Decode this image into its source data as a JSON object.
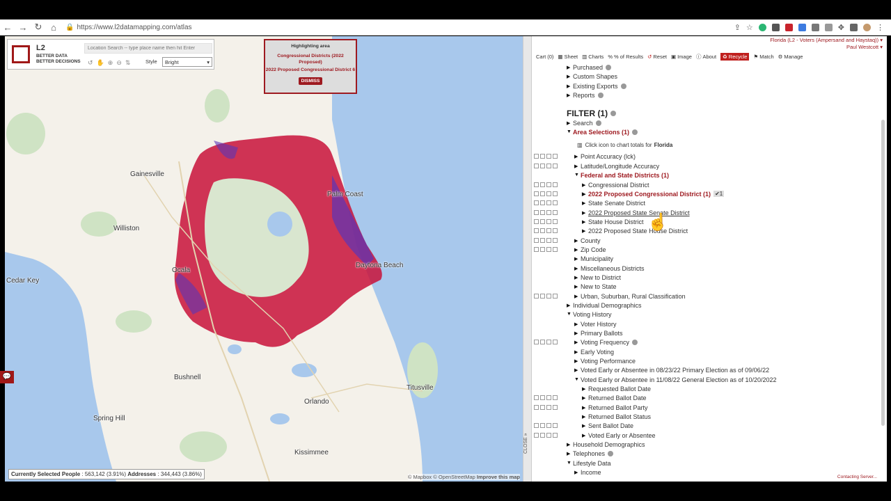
{
  "browser": {
    "url": "https://www.l2datamapping.com/atlas",
    "nav": [
      "back-icon",
      "forward-icon",
      "reload-icon",
      "home-icon"
    ]
  },
  "map": {
    "logo_title": "L2",
    "logo_tagline": "BETTER DATA\nBETTER DECISIONS",
    "search_placeholder": "Location Search -- type place name then hit Enter",
    "style_label": "Style",
    "style_value": "Bright",
    "highlight": {
      "title": "Highlighting area",
      "line1": "Congressional Districts (2022 Proposed)",
      "line2": "2022 Proposed Congressional District 6",
      "dismiss": "DISMISS"
    },
    "cities": [
      "Gainesville",
      "Palm Coast",
      "Williston",
      "Ocala",
      "Daytona Beach",
      "Cedar Key",
      "Bushnell",
      "Titusville",
      "Orlando",
      "Spring Hill",
      "Kissimmee"
    ],
    "status": {
      "people_label": "Currently Selected People",
      "people_value": "563,142 (3.91%)",
      "addresses_label": "Addresses",
      "addresses_value": "344,443 (3.86%)"
    },
    "attribution": "© Mapbox © OpenStreetMap",
    "improve": "Improve this map",
    "close_tab": "CLOSE"
  },
  "panel": {
    "app_title": "Florida (L2 - Voters (Ampersand and Haystaq))",
    "user": "Paul Westcott",
    "tools": {
      "cart": "Cart (0)",
      "sheet": "Sheet",
      "charts": "Charts",
      "results": "% of Results",
      "reset": "Reset",
      "image": "Image",
      "about": "About",
      "recycle": "Recycle",
      "match": "Match",
      "manage": "Manage"
    },
    "rows": [
      {
        "label": "Purchased",
        "indent": 0
      },
      {
        "label": "Custom Shapes",
        "indent": 0
      },
      {
        "label": "Existing Exports",
        "indent": 0
      },
      {
        "label": "Reports",
        "indent": 0
      },
      {
        "label": "FILTER (1)",
        "indent": 0
      },
      {
        "label": "Search",
        "indent": 0
      },
      {
        "label": "Area Selections (1)",
        "indent": 0
      },
      {
        "label": "Click icon to chart totals for",
        "indent": 1
      },
      {
        "label": "Point Accuracy (lck)",
        "indent": 1
      },
      {
        "label": "Latitude/Longitude Accuracy",
        "indent": 1
      },
      {
        "label": "Federal and State Districts (1)",
        "indent": 1
      },
      {
        "label": "Congressional District",
        "indent": 2
      },
      {
        "label": "2022 Proposed Congressional District (1)",
        "indent": 2
      },
      {
        "label": "State Senate District",
        "indent": 2
      },
      {
        "label": "2022 Proposed State Senate District",
        "indent": 2
      },
      {
        "label": "State House District",
        "indent": 2
      },
      {
        "label": "2022 Proposed State House District",
        "indent": 2
      },
      {
        "label": "County",
        "indent": 1
      },
      {
        "label": "Zip Code",
        "indent": 1
      },
      {
        "label": "Municipality",
        "indent": 1
      },
      {
        "label": "Miscellaneous Districts",
        "indent": 1
      },
      {
        "label": "New to District",
        "indent": 1
      },
      {
        "label": "New to State",
        "indent": 1
      },
      {
        "label": "Urban, Suburban, Rural Classification",
        "indent": 1
      },
      {
        "label": "Individual Demographics",
        "indent": 0
      },
      {
        "label": "Voting History",
        "indent": 0
      },
      {
        "label": "Voter History",
        "indent": 1
      },
      {
        "label": "Primary Ballots",
        "indent": 1
      },
      {
        "label": "Voting Frequency",
        "indent": 1
      },
      {
        "label": "Early Voting",
        "indent": 1
      },
      {
        "label": "Voting Performance",
        "indent": 1
      },
      {
        "label": "Voted Early or Absentee in 08/23/22 Primary Election as of 09/06/22",
        "indent": 1
      },
      {
        "label": "Voted Early or Absentee in 11/08/22 General Election as of 10/20/2022",
        "indent": 1
      },
      {
        "label": "Requested Ballot Date",
        "indent": 2
      },
      {
        "label": "Returned Ballot Date",
        "indent": 2
      },
      {
        "label": "Returned Ballot Party",
        "indent": 2
      },
      {
        "label": "Returned Ballot Status",
        "indent": 2
      },
      {
        "label": "Sent Ballot Date",
        "indent": 2
      },
      {
        "label": "Voted Early or Absentee",
        "indent": 2
      },
      {
        "label": "Household Demographics",
        "indent": 0
      },
      {
        "label": "Telephones",
        "indent": 0
      },
      {
        "label": "Lifestyle Data",
        "indent": 0
      },
      {
        "label": "Income",
        "indent": 1
      }
    ],
    "state_name": "Florida",
    "check_count": "1",
    "contacting": "Contacting Server..."
  }
}
